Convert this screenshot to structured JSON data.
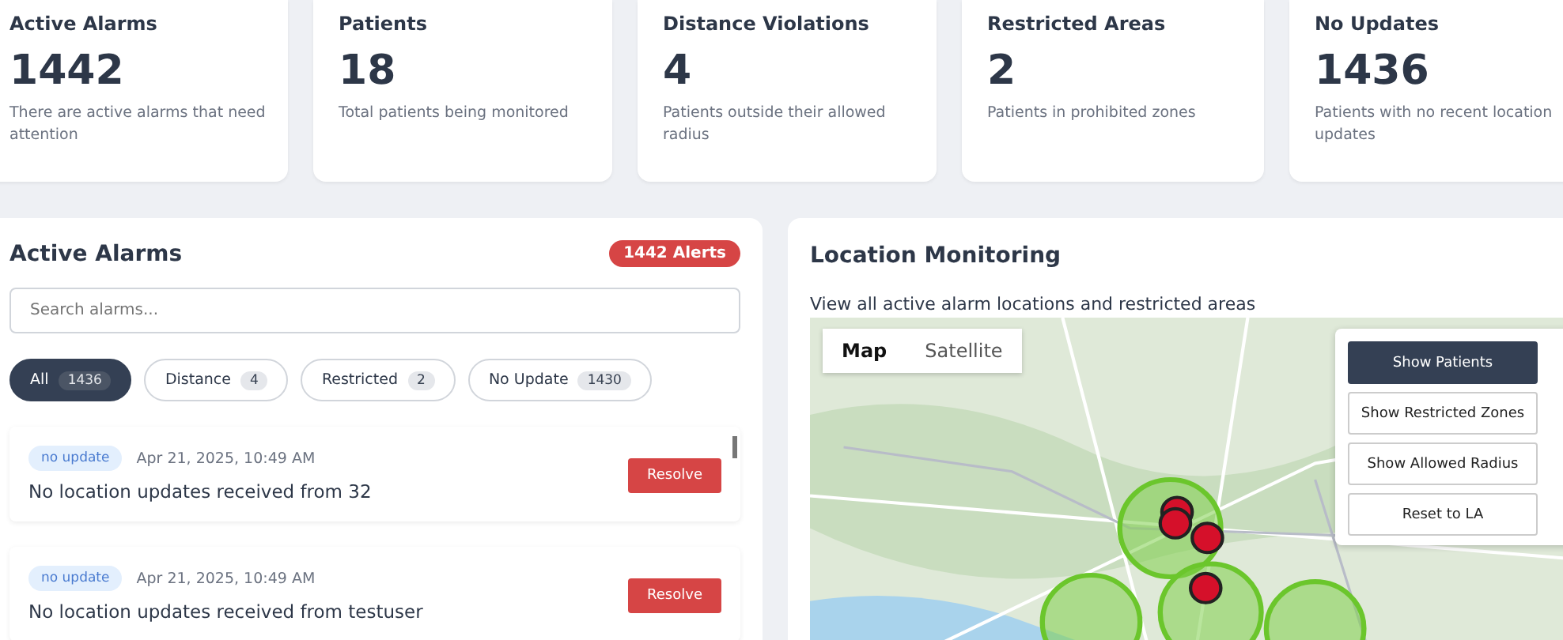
{
  "stats": [
    {
      "title": "Active Alarms",
      "value": "1442",
      "note": "There are active alarms that need attention"
    },
    {
      "title": "Patients",
      "value": "18",
      "note": "Total patients being monitored"
    },
    {
      "title": "Distance Violations",
      "value": "4",
      "note": "Patients outside their allowed radius"
    },
    {
      "title": "Restricted Areas",
      "value": "2",
      "note": "Patients in prohibited zones"
    },
    {
      "title": "No Updates",
      "value": "1436",
      "note": "Patients with no recent location updates"
    }
  ],
  "alarms": {
    "title": "Active Alarms",
    "badge": "1442 Alerts",
    "search": {
      "placeholder": "Search alarms..."
    },
    "filters": [
      {
        "label": "All",
        "count": "1436",
        "selected": true
      },
      {
        "label": "Distance",
        "count": "4",
        "selected": false
      },
      {
        "label": "Restricted",
        "count": "2",
        "selected": false
      },
      {
        "label": "No Update",
        "count": "1430",
        "selected": false
      }
    ],
    "items": [
      {
        "tag": "no update",
        "time": "Apr 21, 2025, 10:49 AM",
        "message": "No location updates received from 32",
        "action": "Resolve"
      },
      {
        "tag": "no update",
        "time": "Apr 21, 2025, 10:49 AM",
        "message": "No location updates received from testuser",
        "action": "Resolve"
      }
    ]
  },
  "location": {
    "title": "Location Monitoring",
    "subtitle": "View all active alarm locations and restricted areas",
    "map_types": [
      {
        "label": "Map",
        "selected": true
      },
      {
        "label": "Satellite",
        "selected": false
      }
    ],
    "controls": [
      {
        "label": "Show Patients",
        "selected": true
      },
      {
        "label": "Show Restricted Zones",
        "selected": false
      },
      {
        "label": "Show Allowed Radius",
        "selected": false
      },
      {
        "label": "Reset to LA",
        "selected": false
      }
    ]
  }
}
